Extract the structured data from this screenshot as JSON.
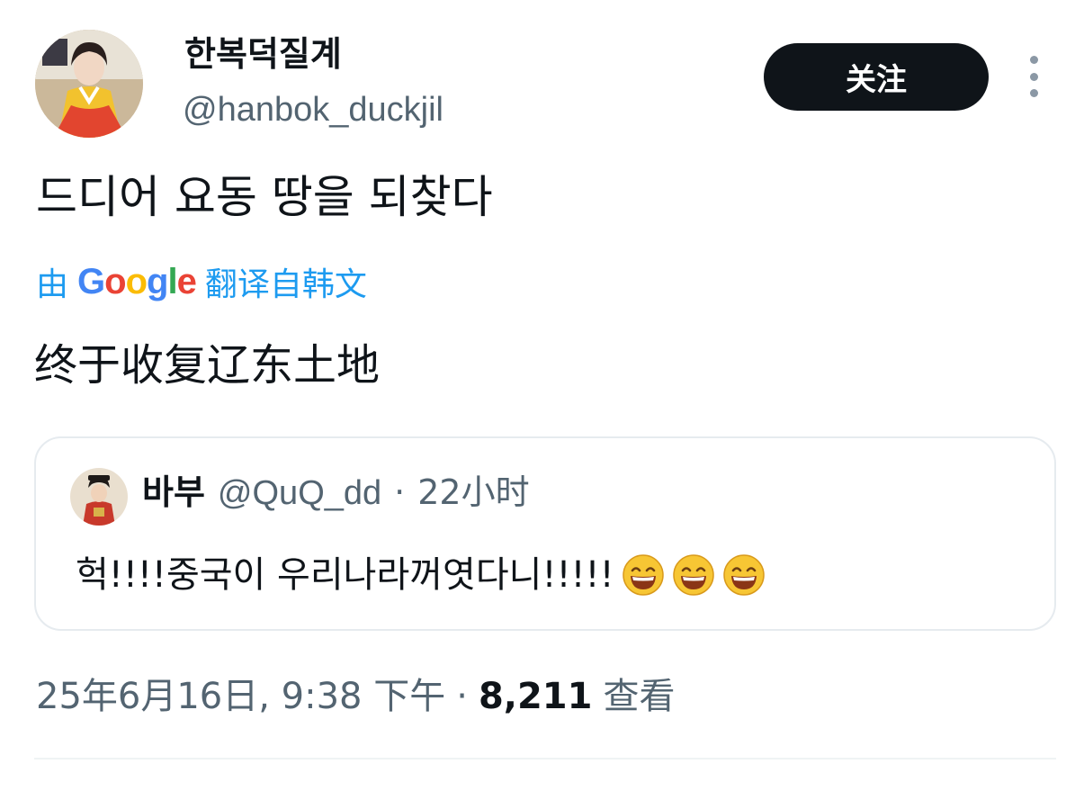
{
  "author": {
    "display_name": "한복덕질계",
    "handle": "@hanbok_duckjil",
    "avatar_icon": "hanbok-portrait-avatar"
  },
  "follow_button": {
    "label": "关注"
  },
  "more_menu": {
    "icon": "more-vertical-icon"
  },
  "tweet": {
    "text": "드디어 요동 땅을 되찾다",
    "translation_prefix": "由",
    "translation_provider": "Google",
    "translation_suffix": "翻译自韩文",
    "translated_text": "终于收复辽东土地"
  },
  "quoted_tweet": {
    "display_name": "바부",
    "handle": "@QuQ_dd",
    "separator": "·",
    "time": "22小时",
    "text": "헉!!!!중국이 우리나라꺼엿다니!!!!!",
    "emoji": [
      "grinning-squint-emoji",
      "grinning-squint-emoji",
      "grinning-squint-emoji"
    ]
  },
  "meta": {
    "timestamp": "25年6月16日, 9:38 下午",
    "separator": "·",
    "views_count": "8,211",
    "views_label": "查看"
  },
  "colors": {
    "text_primary": "#0f1419",
    "text_secondary": "#536471",
    "link_blue": "#1d9bf0",
    "button_bg": "#0f1419",
    "border": "#e6ebef"
  }
}
